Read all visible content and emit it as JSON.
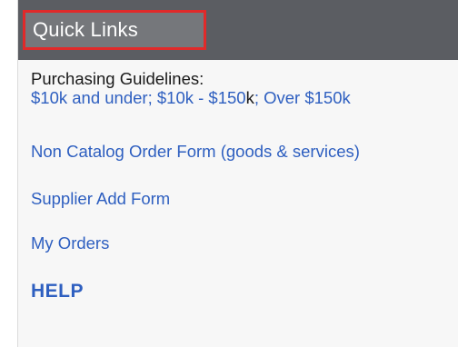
{
  "quick_links": {
    "title": "Quick Links",
    "guidelines_label": "Purchasing Guidelines:",
    "guidelines": {
      "under_10k": "$10k and under",
      "sep1": "; ",
      "range_10k_150k_a": "$10k - $150",
      "range_10k_150k_b": "k",
      "sep2": "; ",
      "over_150k": "Over $150k"
    },
    "non_catalog": "Non Catalog Order Form (goods & services)",
    "supplier_add": "Supplier Add Form",
    "my_orders": "My Orders",
    "help": "HELP"
  },
  "colors": {
    "header_bg": "#5b5d62",
    "highlight_border": "#e02a2a",
    "link": "#2e5fc0"
  }
}
